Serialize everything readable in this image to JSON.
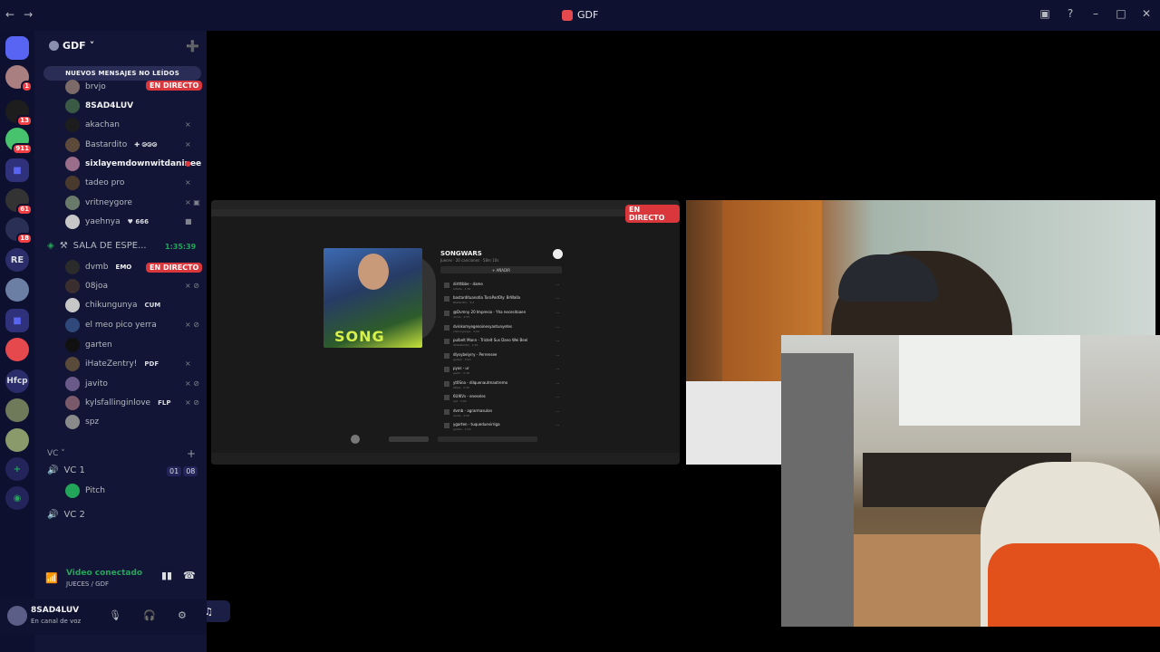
{
  "window": {
    "title": "GDF"
  },
  "guilds": {
    "items": [
      {
        "name": "discord-home",
        "label": "",
        "badge": ""
      },
      {
        "name": "server-1",
        "label": "",
        "badge": "1"
      },
      {
        "name": "server-2",
        "label": "",
        "badge": "13"
      },
      {
        "name": "server-3",
        "label": "",
        "badge": "911"
      },
      {
        "name": "folder-1",
        "label": "",
        "badge": ""
      },
      {
        "name": "server-4",
        "label": "",
        "badge": "61"
      },
      {
        "name": "server-5",
        "label": "",
        "badge": "18"
      },
      {
        "name": "server-re",
        "label": "RE",
        "badge": ""
      },
      {
        "name": "server-6",
        "label": "",
        "badge": ""
      },
      {
        "name": "folder-2",
        "label": "",
        "badge": ""
      },
      {
        "name": "server-7",
        "label": "",
        "badge": ""
      },
      {
        "name": "server-hfcp",
        "label": "Hfcp",
        "badge": ""
      },
      {
        "name": "server-8",
        "label": "",
        "badge": ""
      },
      {
        "name": "server-9",
        "label": "",
        "badge": ""
      }
    ]
  },
  "server": {
    "name": "GDF",
    "new_messages": "NUEVOS MENSAJES NO LEÍDOS"
  },
  "voice1": {
    "members": [
      {
        "name": "brvjo",
        "tag": "",
        "live": "EN DIRECTO",
        "active": false
      },
      {
        "name": "8SAD4LUV",
        "tag": "",
        "live": "",
        "active": true
      },
      {
        "name": "akachan",
        "tag": "",
        "live": "",
        "active": false
      },
      {
        "name": "Bastardito",
        "tag": "✚ ⧁⧁⧁",
        "live": "",
        "active": false
      },
      {
        "name": "sixlayemdownwitdaninee",
        "tag": "",
        "live": "",
        "active": true
      },
      {
        "name": "tadeo pro",
        "tag": "",
        "live": "",
        "active": false
      },
      {
        "name": "vritneygore",
        "tag": "",
        "live": "",
        "active": false
      },
      {
        "name": "yaehnya",
        "tag": "♥ 666",
        "live": "",
        "active": false
      }
    ]
  },
  "sala": {
    "name": "SALA DE ESPE...",
    "timer": "1:35:39",
    "members": [
      {
        "name": "dvmb",
        "tag": "EMO",
        "live": "EN DIRECTO"
      },
      {
        "name": "08joa",
        "tag": "",
        "live": ""
      },
      {
        "name": "chikungunya",
        "tag": "CUM",
        "live": ""
      },
      {
        "name": "el meo pico yerra",
        "tag": "",
        "live": ""
      },
      {
        "name": "garten",
        "tag": "",
        "live": ""
      },
      {
        "name": "iHateZentry!",
        "tag": "PDF",
        "live": ""
      },
      {
        "name": "javito",
        "tag": "",
        "live": ""
      },
      {
        "name": "kylsfallinginlove",
        "tag": "FLP",
        "live": ""
      },
      {
        "name": "spz",
        "tag": "",
        "live": ""
      }
    ]
  },
  "vc_section": {
    "label": "VC ˅"
  },
  "vc1": {
    "name": "VC 1",
    "count_a": "01",
    "count_b": "08",
    "member": "Pitch"
  },
  "vc2": {
    "name": "VC 2"
  },
  "voice_status": {
    "title": "Video conectado",
    "sub": "JUECES / GDF"
  },
  "user": {
    "name": "8SAD4LUV",
    "status": "En canal de voz"
  },
  "stream1": {
    "live": "EN DIRECTO",
    "playlist_title": "SONGWARS",
    "playlist_sub": "Jueces · 20 canciones · 58m 10s",
    "add_label": "+ AÑADIR",
    "cover_text": "SONG",
    "tracks": [
      {
        "title": "dirtttbbe - dame",
        "artist": "artista · 1:30",
        "time": "..."
      },
      {
        "title": "bastardituanotia TaraPodOly: BrWalla",
        "artist": "Bastardito · 3:2",
        "time": "..."
      },
      {
        "title": "@Dvmny 20 Impresio - Yha necesitoaen",
        "artist": "dvmb · 2:55",
        "time": "..."
      },
      {
        "title": "dvinkomyegenoinesyantunyetes",
        "artist": "chikungunya · 3:02",
        "time": "..."
      },
      {
        "title": "pulbelt Mann - Tristelt Sus Dano Wei Beel",
        "artist": "iHateZentry · 2:41",
        "time": "..."
      },
      {
        "title": "dlysybelyrry - Perrensee",
        "artist": "garten · 3:10",
        "time": "..."
      },
      {
        "title": "pyas - ur",
        "artist": "javito · 2:18",
        "time": "..."
      },
      {
        "title": "yt0Sna - dilquenautmaotremo",
        "artist": "08joa · 2:40",
        "time": "..."
      },
      {
        "title": "6UIKVs - eneseles",
        "artist": "spz · 3:04",
        "time": "..."
      },
      {
        "title": "dvmb - agrarmasulon",
        "artist": "dvmb · 2:50",
        "time": "..."
      },
      {
        "title": "ygarten - tuqueduevirriga",
        "artist": "garten · 2:33",
        "time": "..."
      }
    ]
  },
  "icons": {
    "back": "←",
    "forward": "→",
    "inbox": "▣",
    "help": "?",
    "minimize": "–",
    "maximize": "□",
    "close": "✕",
    "add_friend": "➕",
    "mute": "🎙",
    "headset": "🎧",
    "settings": "⚙",
    "signal": "📶",
    "disconnect": "☎",
    "speaker": "🔊",
    "deafened": "⊘"
  }
}
